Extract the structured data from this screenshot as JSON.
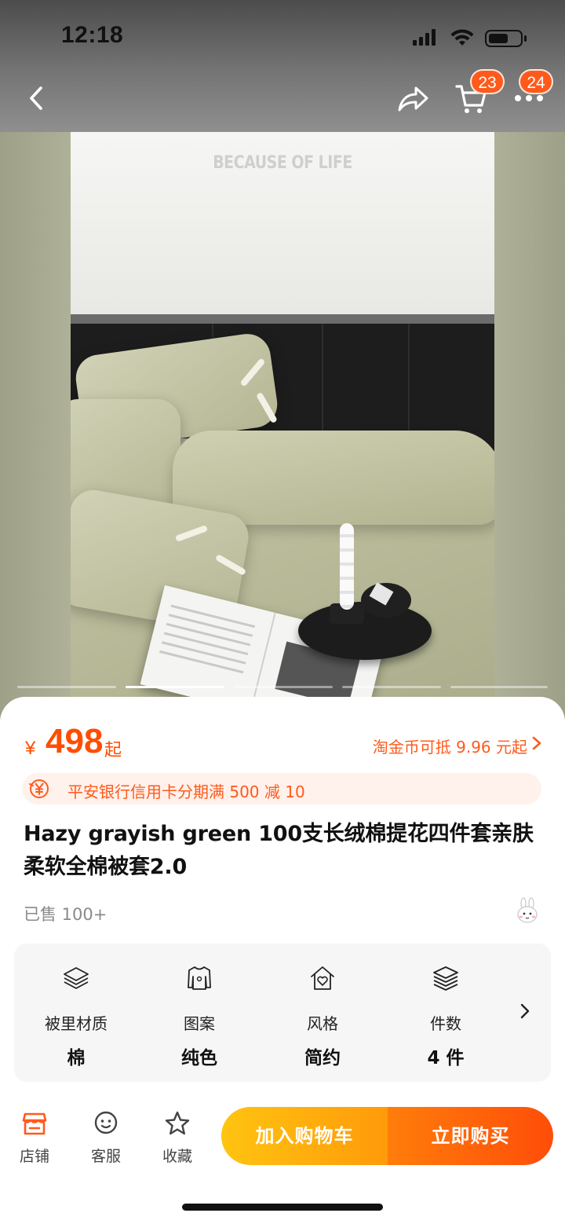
{
  "status_bar": {
    "time": "12:18"
  },
  "nav": {
    "cart_badge": "23",
    "more_badge": "24"
  },
  "hero": {
    "wall_text": "BECAUSE OF LIFE",
    "page_count": 5,
    "active_page": 2
  },
  "price": {
    "currency": "¥",
    "amount": "498",
    "suffix": "起"
  },
  "coin_offer": "淘金币可抵 9.96 元起",
  "promo": "平安银行信用卡分期满 500 减 10",
  "product": {
    "title": "Hazy grayish green 100支长绒棉提花四件套亲肤柔软全棉被套2.0",
    "sold": "已售 100+"
  },
  "attributes": [
    {
      "label": "被里材质",
      "value": "棉",
      "icon": "layers-icon"
    },
    {
      "label": "图案",
      "value": "纯色",
      "icon": "shirt-icon"
    },
    {
      "label": "风格",
      "value": "简约",
      "icon": "house-heart-icon"
    },
    {
      "label": "件数",
      "value": "4 件",
      "icon": "stack-icon"
    }
  ],
  "bottom_bar": {
    "shop": "店铺",
    "service": "客服",
    "favorite": "收藏",
    "add_to_cart": "加入购物车",
    "buy_now": "立即购买"
  },
  "colors": {
    "accent": "#ff5a1b",
    "cart_button": "#ffb20d",
    "buy_button": "#ff5a0a"
  }
}
